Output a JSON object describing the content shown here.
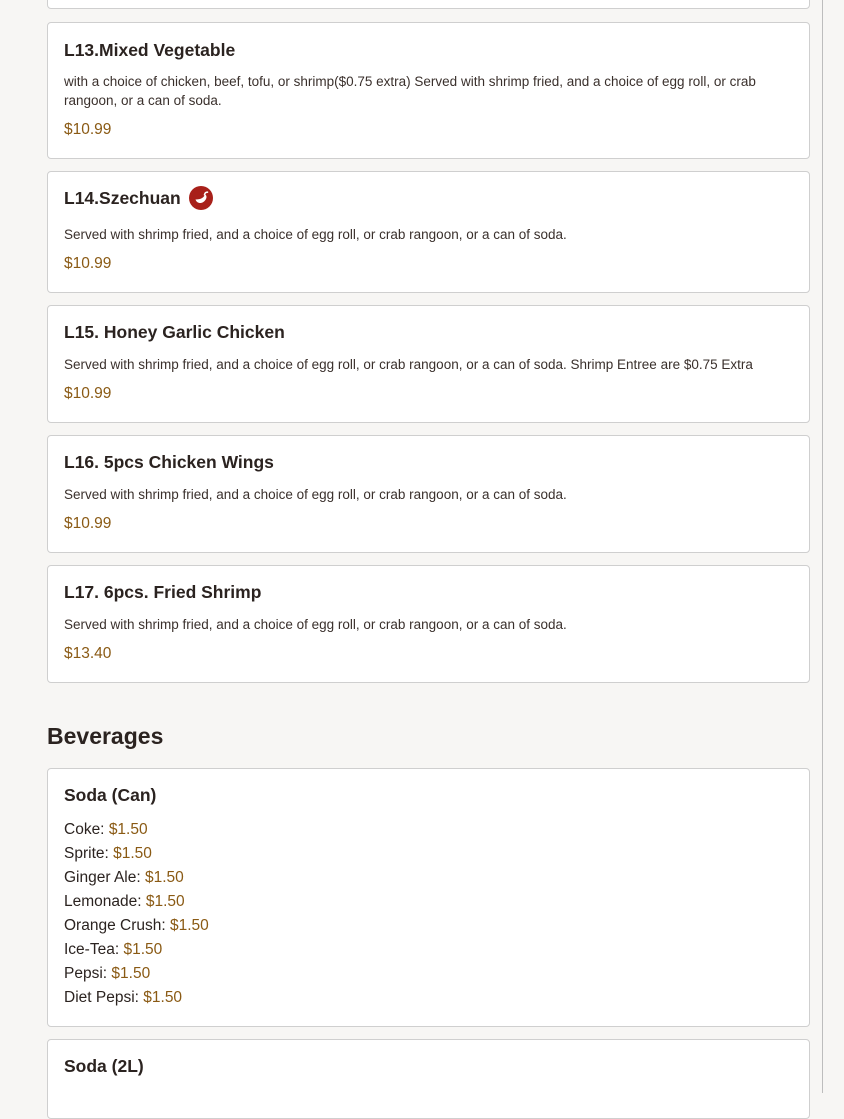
{
  "items": [
    {
      "name": "L13.Mixed Vegetable",
      "description": "with a choice of chicken, beef, tofu, or shrimp($0.75 extra) Served with shrimp fried, and a choice of egg roll, or crab rangoon, or a can of soda.",
      "price": "$10.99",
      "spicy": false
    },
    {
      "name": "L14.Szechuan",
      "description": "Served with shrimp fried, and a choice of egg roll, or crab rangoon, or a can of soda.",
      "price": "$10.99",
      "spicy": true
    },
    {
      "name": "L15. Honey Garlic Chicken",
      "description": "Served with shrimp fried, and a choice of egg roll, or crab rangoon, or a can of soda. Shrimp Entree are $0.75 Extra",
      "price": "$10.99",
      "spicy": false
    },
    {
      "name": "L16. 5pcs Chicken Wings",
      "description": "Served with shrimp fried, and a choice of egg roll, or crab rangoon, or a can of soda.",
      "price": "$10.99",
      "spicy": false
    },
    {
      "name": "L17. 6pcs. Fried Shrimp",
      "description": "Served with shrimp fried, and a choice of egg roll, or crab rangoon, or a can of soda.",
      "price": "$13.40",
      "spicy": false
    }
  ],
  "beverages": {
    "heading": "Beverages",
    "soda_can": {
      "title": "Soda (Can)",
      "options": [
        {
          "label": "Coke:",
          "price": "$1.50"
        },
        {
          "label": "Sprite:",
          "price": "$1.50"
        },
        {
          "label": "Ginger Ale:",
          "price": "$1.50"
        },
        {
          "label": "Lemonade:",
          "price": "$1.50"
        },
        {
          "label": "Orange Crush:",
          "price": "$1.50"
        },
        {
          "label": "Ice-Tea:",
          "price": "$1.50"
        },
        {
          "label": "Pepsi:",
          "price": "$1.50"
        },
        {
          "label": "Diet Pepsi:",
          "price": "$1.50"
        }
      ]
    },
    "soda_2l": {
      "title": "Soda (2L)"
    }
  },
  "colors": {
    "price": "#8a5a14",
    "chili_badge": "#a8201a"
  },
  "icons": {
    "spicy": "chili-pepper-icon"
  }
}
